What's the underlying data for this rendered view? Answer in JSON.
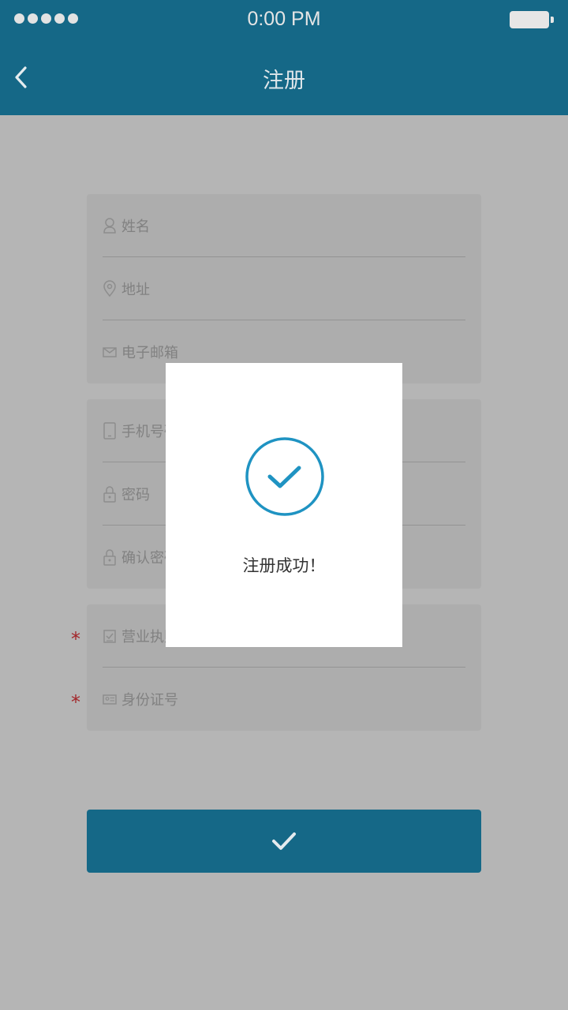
{
  "status_bar": {
    "time": "0:00 PM",
    "signal_dots": 5
  },
  "nav": {
    "title": "注册",
    "back_icon": "chevron-left-icon"
  },
  "form": {
    "group1": [
      {
        "icon": "user-icon",
        "placeholder": "姓名"
      },
      {
        "icon": "location-pin-icon",
        "placeholder": "地址"
      },
      {
        "icon": "envelope-icon",
        "placeholder": "电子邮箱"
      }
    ],
    "group2": [
      {
        "icon": "phone-icon",
        "placeholder": "手机号码"
      },
      {
        "icon": "lock-icon",
        "placeholder": "密码"
      },
      {
        "icon": "lock-icon",
        "placeholder": "确认密码"
      }
    ],
    "group3": [
      {
        "icon": "checklist-icon",
        "placeholder": "营业执照",
        "required_mark": "*"
      },
      {
        "icon": "id-card-icon",
        "placeholder": "身份证号",
        "required_mark": "*"
      }
    ]
  },
  "submit": {
    "icon": "checkmark-icon"
  },
  "dialog": {
    "message": "注册成功！",
    "icon": "check-circle-icon"
  },
  "colors": {
    "primary": "#156887",
    "accent": "#1f93c2",
    "overlay_background": "#b5b5b5",
    "required": "#a3262a"
  }
}
